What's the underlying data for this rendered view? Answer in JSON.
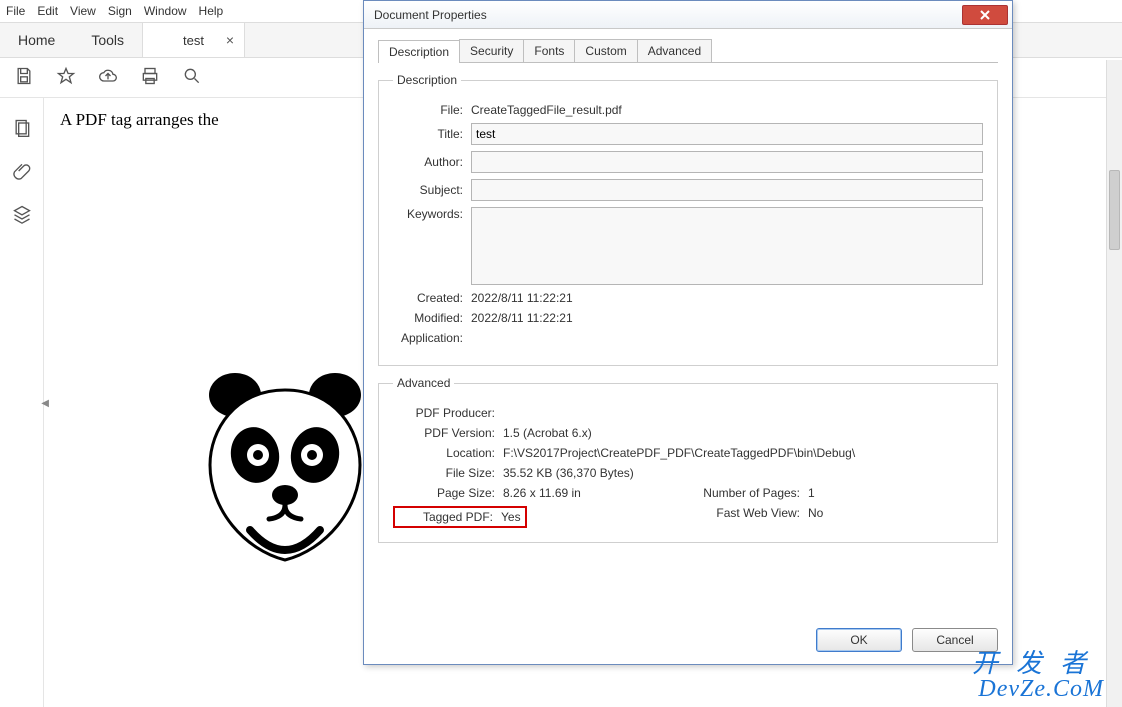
{
  "menubar": {
    "items": [
      "File",
      "Edit",
      "View",
      "Sign",
      "Window",
      "Help"
    ]
  },
  "tabbar": {
    "home": "Home",
    "tools": "Tools",
    "doc_title": "test"
  },
  "document": {
    "body_line": "A PDF tag arranges the"
  },
  "dialog": {
    "title": "Document Properties",
    "tabs": [
      "Description",
      "Security",
      "Fonts",
      "Custom",
      "Advanced"
    ],
    "active_tab": 0,
    "description": {
      "legend": "Description",
      "file_label": "File:",
      "file_value": "CreateTaggedFile_result.pdf",
      "title_label": "Title:",
      "title_value": "test",
      "author_label": "Author:",
      "author_value": "",
      "subject_label": "Subject:",
      "subject_value": "",
      "keywords_label": "Keywords:",
      "keywords_value": "",
      "created_label": "Created:",
      "created_value": "2022/8/11 11:22:21",
      "modified_label": "Modified:",
      "modified_value": "2022/8/11 11:22:21",
      "application_label": "Application:",
      "application_value": ""
    },
    "advanced": {
      "legend": "Advanced",
      "producer_label": "PDF Producer:",
      "producer_value": "",
      "version_label": "PDF Version:",
      "version_value": "1.5 (Acrobat 6.x)",
      "location_label": "Location:",
      "location_value": "F:\\VS2017Project\\CreatePDF_PDF\\CreateTaggedPDF\\bin\\Debug\\",
      "filesize_label": "File Size:",
      "filesize_value": "35.52 KB (36,370 Bytes)",
      "pagesize_label": "Page Size:",
      "pagesize_value": "8.26 x 11.69 in",
      "numpages_label": "Number of Pages:",
      "numpages_value": "1",
      "tagged_label": "Tagged PDF:",
      "tagged_value": "Yes",
      "fastweb_label": "Fast Web View:",
      "fastweb_value": "No"
    },
    "buttons": {
      "ok": "OK",
      "cancel": "Cancel"
    }
  },
  "watermark": {
    "line1": "开发者",
    "line2": "DevZe.CoM"
  }
}
